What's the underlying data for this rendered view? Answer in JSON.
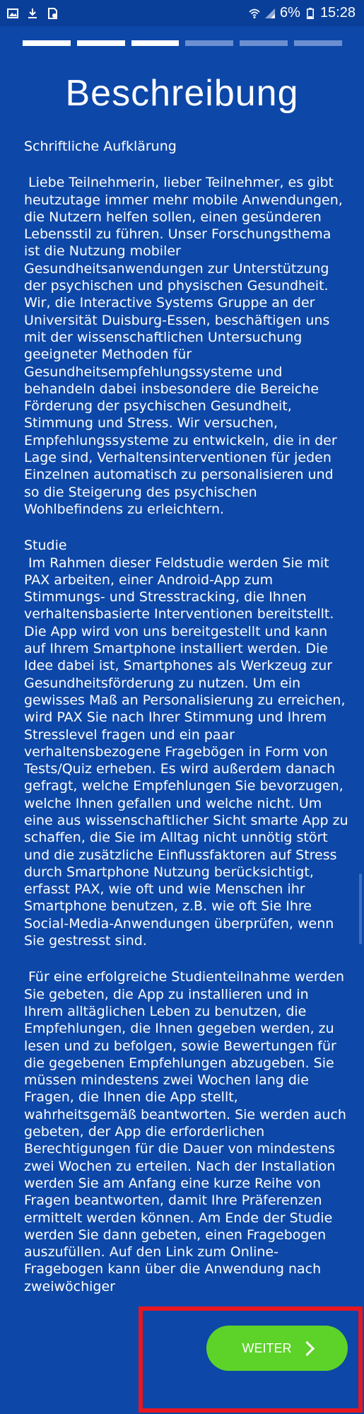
{
  "status_bar": {
    "time": "15:28",
    "battery": "6%",
    "icons_left": [
      "image-icon",
      "download-icon",
      "sd-card-icon"
    ],
    "icons_right": [
      "wifi-icon",
      "signal-icon",
      "battery-icon"
    ]
  },
  "progress": {
    "total_steps": 6,
    "completed_steps": 3
  },
  "page": {
    "title": "Beschreibung"
  },
  "content": {
    "heading": "Schriftliche Aufklärung",
    "p1": " Liebe Teilnehmerin, lieber Teilnehmer, es gibt heutzutage immer mehr mobile Anwendungen, die Nutzern helfen sollen, einen gesünderen Lebensstil zu führen. Unser Forschungsthema ist die Nutzung mobiler Gesundheitsanwendungen zur Unterstützung der psychischen und physischen Gesundheit. Wir, die Interactive Systems Gruppe an der Universität Duisburg-Essen, beschäftigen uns mit der wissenschaftlichen Untersuchung geeigneter Methoden für Gesundheitsempfehlungssysteme und behandeln dabei insbesondere die Bereiche Förderung der psychischen Gesundheit, Stimmung und Stress. Wir versuchen, Empfehlungssysteme zu entwickeln, die in der Lage sind, Verhaltensinterventionen für jeden Einzelnen automatisch zu personalisieren und so die Steigerung des psychischen Wohlbefindens zu erleichtern.",
    "study_heading": "Studie",
    "p2": " Im Rahmen dieser Feldstudie werden Sie mit PAX arbeiten, einer Android-App zum Stimmungs- und Stresstracking, die Ihnen verhaltensbasierte Interventionen bereitstellt. Die App wird von uns bereitgestellt und kann auf Ihrem Smartphone installiert werden. Die Idee dabei ist, Smartphones als Werkzeug zur Gesundheitsförderung zu nutzen. Um ein gewisses Maß an Personalisierung zu erreichen, wird PAX Sie nach Ihrer Stimmung und Ihrem Stresslevel fragen und ein paar verhaltensbezogene Fragebögen in Form von Tests/Quiz erheben. Es wird außerdem danach gefragt, welche Empfehlungen Sie bevorzugen, welche Ihnen gefallen und welche nicht. Um eine aus wissenschaftlicher Sicht smarte App zu schaffen, die Sie im Alltag nicht unnötig stört und die zusätzliche Einflussfaktoren auf Stress durch Smartphone Nutzung berücksichtigt, erfasst PAX, wie oft und wie Menschen ihr Smartphone benutzen, z.B. wie oft Sie Ihre Social-Media-Anwendungen überprüfen, wenn Sie gestresst sind.",
    "p3": " Für eine erfolgreiche Studienteilnahme werden Sie gebeten, die App zu installieren und in Ihrem alltäglichen Leben zu benutzen, die Empfehlungen, die Ihnen gegeben werden, zu lesen und zu befolgen, sowie Bewertungen für die gegebenen Empfehlungen abzugeben. Sie müssen mindestens zwei Wochen lang die Fragen, die Ihnen die App stellt, wahrheitsgemäß beantworten. Sie werden auch gebeten, der App die erforderlichen Berechtigungen für die Dauer von mindestens zwei Wochen zu erteilen. Nach der Installation werden Sie am Anfang eine kurze Reihe von Fragen beantworten, damit Ihre Präferenzen ermittelt werden können. Am Ende der Studie werden Sie dann gebeten, einen Fragebogen auszufüllen. Auf den Link zum Online-Fragebogen kann über die Anwendung nach zweiwöchiger"
  },
  "button": {
    "next_label": "WEITER"
  },
  "colors": {
    "background": "#0d47a8",
    "button": "#5dd229",
    "highlight": "#e9161e"
  }
}
